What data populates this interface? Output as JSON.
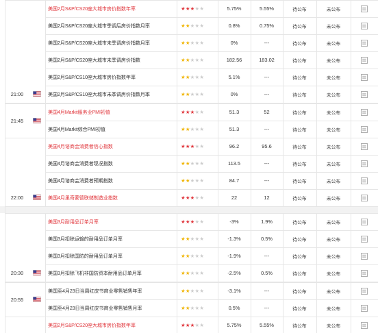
{
  "colors": {
    "highlight_text": "#e0353b",
    "three_star": "#e0353b",
    "two_star": "#f0b400",
    "empty_star": "#cccccc",
    "grid_line": "#e6e6e6",
    "block_gap": "#f2f2f2"
  },
  "icons": {
    "country_flag": "us-flag-icon",
    "detail": "document-icon",
    "star": "star-icon"
  },
  "blocks": [
    {
      "time": "21:00",
      "flag": true
    },
    {
      "time": "21:45",
      "flag": true
    },
    {
      "time": "22:00",
      "flag": true
    },
    {
      "time": "20:30",
      "flag": true
    },
    {
      "time": "20:55",
      "flag": true
    },
    {
      "time": "",
      "flag": false
    }
  ],
  "rows": [
    {
      "name": "美国2月S&P/CS20座大城市房价指数年率",
      "highlight": true,
      "stars": 3,
      "previous": "5.75%",
      "forecast": "5.55%",
      "actual": "待公布",
      "impact": "未公布"
    },
    {
      "name": "美国2月S&P/CS20座大城市季调后房价指数月率",
      "highlight": false,
      "stars": 2,
      "previous": "0.8%",
      "forecast": "0.75%",
      "actual": "待公布",
      "impact": "未公布"
    },
    {
      "name": "美国2月S&P/CS20座大城市未季调房价指数月率",
      "highlight": false,
      "stars": 2,
      "previous": "0%",
      "forecast": "---",
      "actual": "待公布",
      "impact": "未公布"
    },
    {
      "name": "美国2月S&P/CS20座大城市未季调房价指数",
      "highlight": false,
      "stars": 2,
      "previous": "182.56",
      "forecast": "183.02",
      "actual": "待公布",
      "impact": "未公布"
    },
    {
      "name": "美国2月S&P/CS10座大城市房价指数年率",
      "highlight": false,
      "stars": 2,
      "previous": "5.1%",
      "forecast": "---",
      "actual": "待公布",
      "impact": "未公布"
    },
    {
      "name": "美国2月S&P/CS10座大城市未季调房价指数月率",
      "highlight": false,
      "stars": 2,
      "previous": "0%",
      "forecast": "---",
      "actual": "待公布",
      "impact": "未公布"
    },
    {
      "name": "美国4月Markit服务业PMI初值",
      "highlight": true,
      "stars": 3,
      "previous": "51.3",
      "forecast": "52",
      "actual": "待公布",
      "impact": "未公布"
    },
    {
      "name": "美国4月Markit综合PMI初值",
      "highlight": false,
      "stars": 2,
      "previous": "51.3",
      "forecast": "---",
      "actual": "待公布",
      "impact": "未公布"
    },
    {
      "name": "美国4月谘商会消费者信心指数",
      "highlight": true,
      "stars": 3,
      "previous": "96.2",
      "forecast": "95.6",
      "actual": "待公布",
      "impact": "未公布"
    },
    {
      "name": "美国4月谘商会消费者现况指数",
      "highlight": false,
      "stars": 2,
      "previous": "113.5",
      "forecast": "---",
      "actual": "待公布",
      "impact": "未公布"
    },
    {
      "name": "美国4月谘商会消费者预期指数",
      "highlight": false,
      "stars": 2,
      "previous": "84.7",
      "forecast": "---",
      "actual": "待公布",
      "impact": "未公布"
    },
    {
      "name": "美国4月里奇蒙德联储制造业指数",
      "highlight": true,
      "stars": 3,
      "previous": "22",
      "forecast": "12",
      "actual": "待公布",
      "impact": "未公布"
    },
    {
      "name": "美国3月耐用品订单月率",
      "highlight": true,
      "stars": 3,
      "previous": "-3%",
      "forecast": "1.9%",
      "actual": "待公布",
      "impact": "未公布"
    },
    {
      "name": "美国3月扣除运输的耐用品订单月率",
      "highlight": false,
      "stars": 2,
      "previous": "-1.3%",
      "forecast": "0.5%",
      "actual": "待公布",
      "impact": "未公布"
    },
    {
      "name": "美国3月扣除国防的耐用品订单月率",
      "highlight": false,
      "stars": 2,
      "previous": "-1.9%",
      "forecast": "---",
      "actual": "待公布",
      "impact": "未公布"
    },
    {
      "name": "美国3月扣除飞机非国防资本耐用品订单月率",
      "highlight": false,
      "stars": 2,
      "previous": "-2.5%",
      "forecast": "0.5%",
      "actual": "待公布",
      "impact": "未公布"
    },
    {
      "name": "美国至4月23日当周红皮书商业零售销售年率",
      "highlight": false,
      "stars": 2,
      "previous": "-3.1%",
      "forecast": "---",
      "actual": "待公布",
      "impact": "未公布"
    },
    {
      "name": "美国至4月23日当周红皮书商业零售销售月率",
      "highlight": false,
      "stars": 2,
      "previous": "0.5%",
      "forecast": "---",
      "actual": "待公布",
      "impact": "未公布"
    },
    {
      "name": "美国2月S&P/CS20座大城市房价指数年率",
      "highlight": true,
      "stars": 3,
      "previous": "5.75%",
      "forecast": "5.55%",
      "actual": "待公布",
      "impact": "未公布"
    }
  ]
}
